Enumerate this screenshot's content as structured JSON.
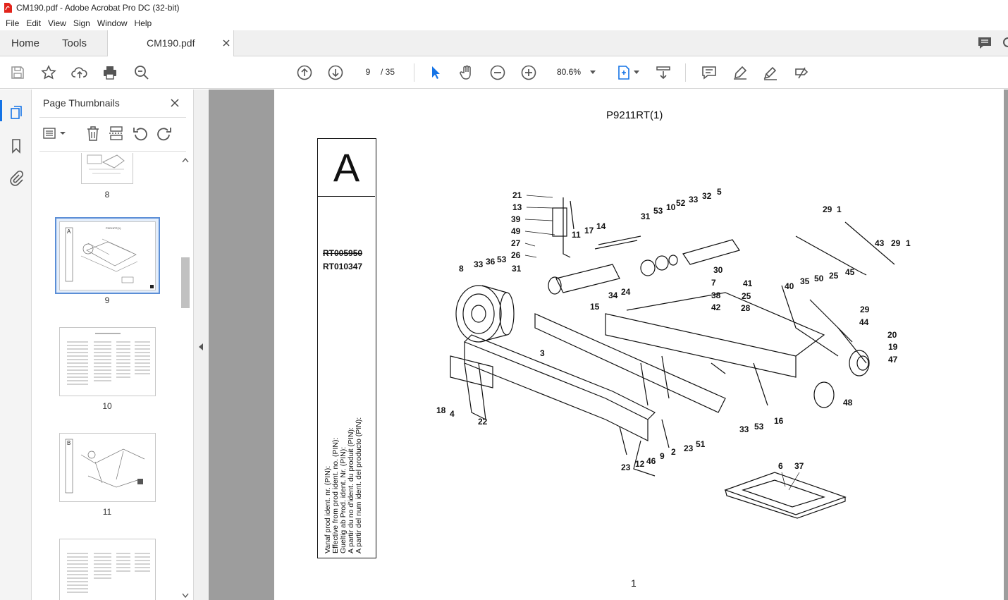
{
  "window": {
    "title": "CM190.pdf - Adobe Acrobat Pro DC (32-bit)"
  },
  "menu": [
    "File",
    "Edit",
    "View",
    "Sign",
    "Window",
    "Help"
  ],
  "tabs": {
    "home": "Home",
    "tools": "Tools",
    "document": "CM190.pdf"
  },
  "toolbar": {
    "page_current": "9",
    "page_total": "/ 35",
    "zoom": "80.6%"
  },
  "thumbnails_panel": {
    "title": "Page Thumbnails",
    "pages": [
      {
        "label": "8"
      },
      {
        "label": "9",
        "selected": true
      },
      {
        "label": "10"
      },
      {
        "label": "11"
      }
    ]
  },
  "document_page": {
    "figure_code": "P9211RT(1)",
    "section_letter": "A",
    "serial_old": "RT005950",
    "serial_new": "RT010347",
    "effective_from_lines": [
      "Vanaf prod ident. nr. (PIN):",
      "Effective from prod ident. no. (PIN):",
      "Gueltig ab Prod. ident. Nr. (PIN):",
      "A partir du no d'ident. du produit (PIN):",
      "A partir del num ident. del producto (PIN):"
    ],
    "page_number": "1",
    "callouts": [
      "21",
      "13",
      "39",
      "49",
      "27",
      "26",
      "31",
      "53",
      "10",
      "52",
      "33",
      "32",
      "5",
      "11",
      "17",
      "14",
      "29",
      "1",
      "43",
      "29",
      "1",
      "8",
      "33",
      "36",
      "53",
      "31",
      "15",
      "34",
      "24",
      "30",
      "7",
      "38",
      "42",
      "41",
      "25",
      "28",
      "40",
      "35",
      "50",
      "25",
      "45",
      "29",
      "44",
      "20",
      "19",
      "47",
      "3",
      "18",
      "4",
      "22",
      "33",
      "53",
      "16",
      "48",
      "23",
      "12",
      "46",
      "9",
      "2",
      "23",
      "51",
      "6",
      "37"
    ]
  },
  "colors": {
    "accent": "#1473e6",
    "canvas": "#9d9d9d"
  }
}
